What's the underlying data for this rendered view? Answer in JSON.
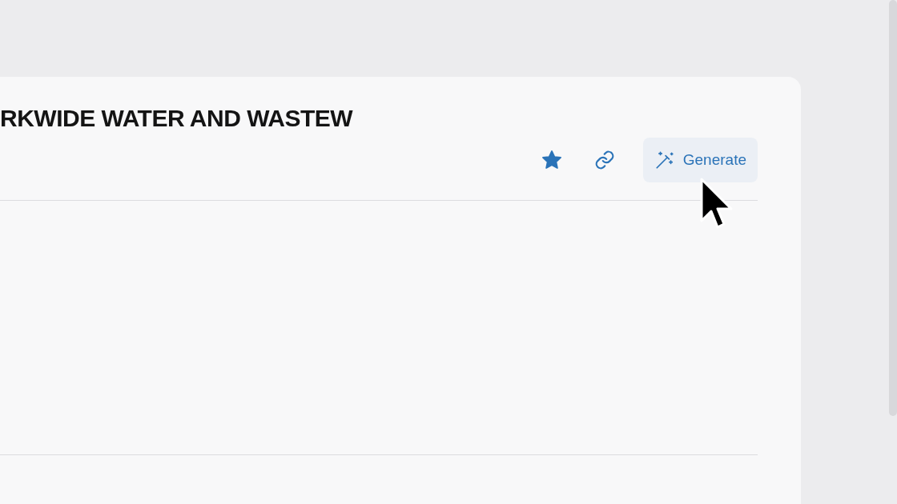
{
  "header": {
    "title": "RKWIDE WATER AND WASTEW",
    "favorited": true
  },
  "actions": {
    "generate_label": "Generate"
  }
}
